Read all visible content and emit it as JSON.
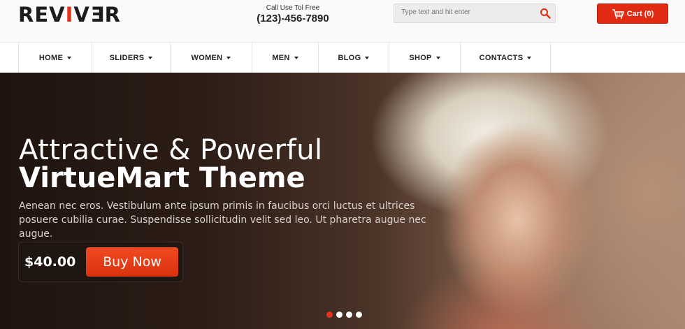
{
  "header": {
    "logo": {
      "part1": "REV",
      "accent": "I",
      "part2": "V",
      "part3": "E",
      "part4": "R"
    },
    "phone": {
      "caption": "Call Use Tol Free",
      "number": "(123)-456-7890"
    },
    "search": {
      "placeholder": "Type text and hit enter",
      "icon": "search-icon"
    },
    "cart": {
      "label": "Cart (0)",
      "icon": "basket-icon"
    }
  },
  "nav": {
    "items": [
      {
        "label": "HOME"
      },
      {
        "label": "SLIDERS"
      },
      {
        "label": "WOMEN"
      },
      {
        "label": "MEN"
      },
      {
        "label": "BLOG"
      },
      {
        "label": "SHOP"
      },
      {
        "label": "CONTACTS"
      }
    ]
  },
  "hero": {
    "title_line1": "Attractive & Powerful",
    "title_line2": "VirtueMart Theme",
    "description": "Aenean nec eros. Vestibulum ante ipsum primis in faucibus orci luctus et ultrices posuere cubilia curae. Suspendisse sollicitudin velit sed leo. Ut pharetra augue nec augue.",
    "price": "$40.00",
    "buy_label": "Buy Now",
    "slider": {
      "total": 4,
      "active": 1
    }
  },
  "colors": {
    "accent": "#e8311b",
    "cart_bg": "#e12b12",
    "buy_bg": "#e3391a"
  }
}
